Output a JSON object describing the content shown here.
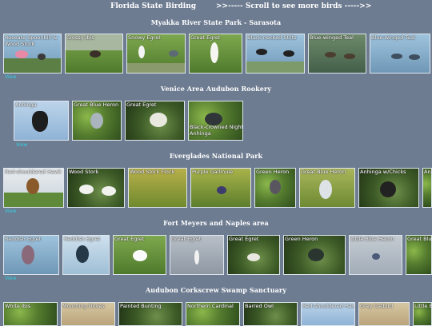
{
  "header": {
    "title": "Florida State Birding",
    "scroll_hint": ">>----- Scroll to see more birds ----->>"
  },
  "sections": [
    {
      "title": "Myakka River State Park - Sarasota",
      "birds": [
        "Roseate Spoonbill &",
        "Glossy Ibis",
        "Snowy Egret",
        "Great Egret",
        "Black-necked Stilts",
        "Blue-winged Teal",
        "Blue-winged Teal"
      ],
      "extra_line": "Wood Stork",
      "view_label": "View"
    },
    {
      "title": "Venice Area Audubon Rookery",
      "birds": [
        "Anhinga",
        "Great Blue Heron",
        "Great Egret",
        "Black-crowned Night Heron",
        "Anhinga"
      ],
      "view_label": "View"
    },
    {
      "title": "Everglades National Park",
      "birds": [
        "Red-shouldered Hawk",
        "Wood Stork",
        "Wood Stork Flock",
        "Purple Gallinule",
        "Green Heron",
        "Great Blue Heron",
        "Anhinga w/Chicks",
        "Anhinga"
      ],
      "view_label": "View"
    },
    {
      "title": "Fort Meyers and Naples area",
      "birds": [
        "Reddish Egret",
        "Reddish Egret",
        "Great Egret",
        "Great Egret",
        "Great Egret",
        "Green Heron",
        "Little Blue Heron",
        "Great Blue"
      ],
      "view_label": "View"
    },
    {
      "title": "Audubon Corkscrew Swamp Sanctuary",
      "birds": [
        "White Ibis",
        "Mourning Doves",
        "Painted Bunting",
        "Northern Cardinal",
        "Barred Owl",
        "Red-shouldered Hawk",
        "Grey Catbird",
        "Little Blue"
      ]
    }
  ]
}
